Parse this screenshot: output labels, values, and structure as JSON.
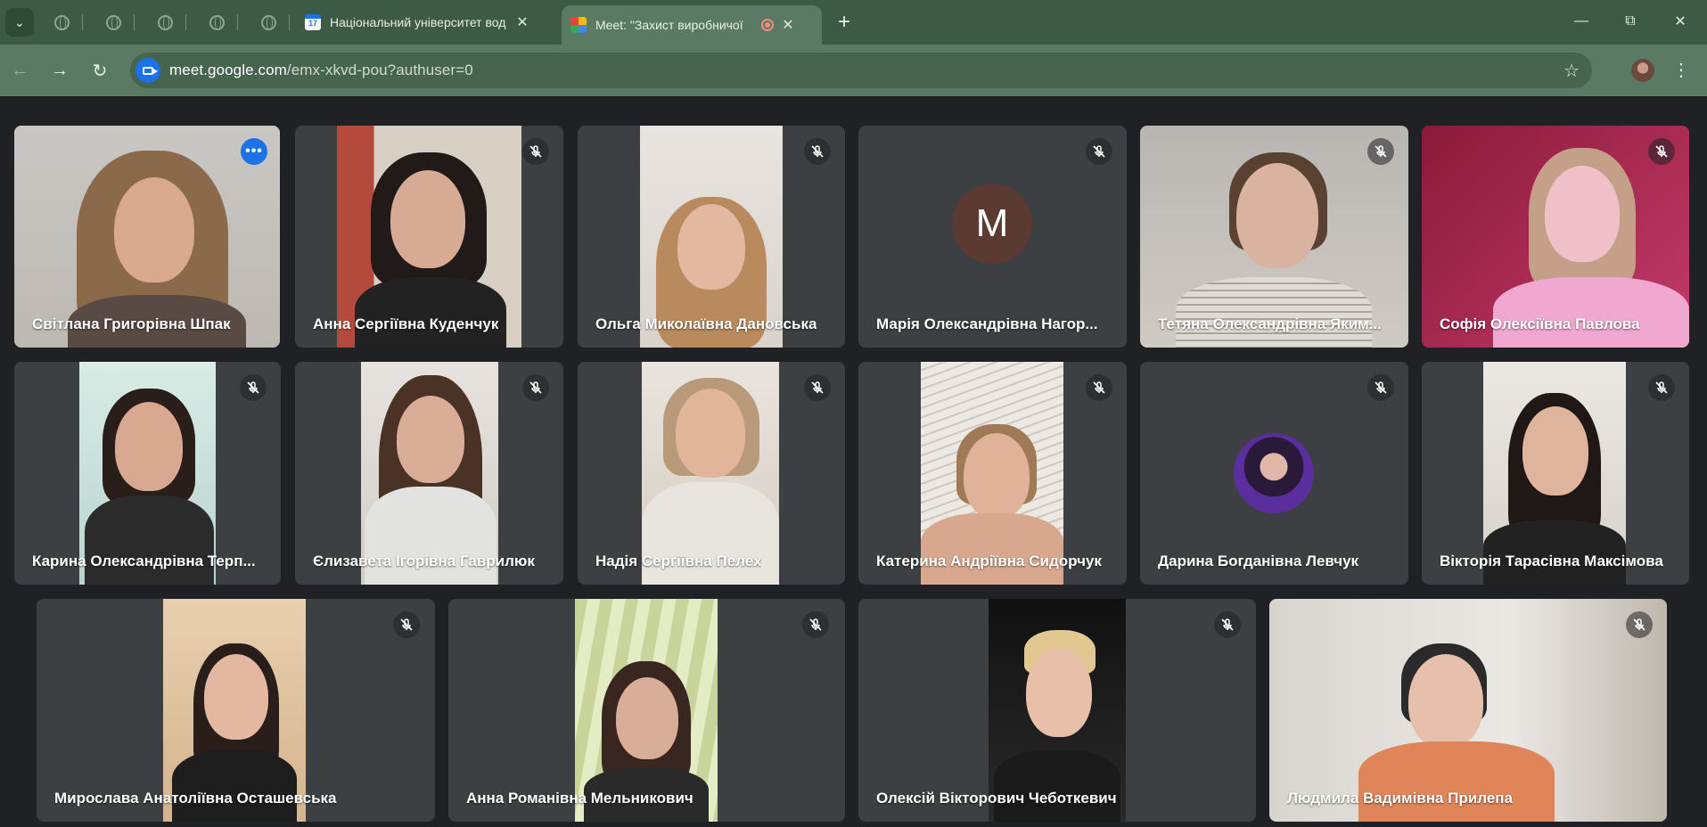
{
  "browser": {
    "tabs": [
      {
        "title": "Національний університет вод"
      },
      {
        "title": "Meet: \"Захист виробничої"
      }
    ],
    "tab1_favicon_text": "17",
    "url_host": "meet.google.com",
    "url_path": "/emx-xkvd-pou?authuser=0"
  },
  "meet": {
    "avatar_letter": "M",
    "participants": [
      {
        "name": "Світлана Григорівна Шпак"
      },
      {
        "name": "Анна Сергіївна Куденчук"
      },
      {
        "name": "Ольга Миколаївна Дановська"
      },
      {
        "name": "Марія Олександрівна Нагор..."
      },
      {
        "name": "Тетяна Олександрівна Яким..."
      },
      {
        "name": "Софія Олексіївна Павлова"
      },
      {
        "name": "Карина Олександрівна Терп..."
      },
      {
        "name": "Єлизавета Ігорівна Гаврилюк"
      },
      {
        "name": "Надія Сергіївна Пелех"
      },
      {
        "name": "Катерина Андріївна Сидорчук"
      },
      {
        "name": "Дарина Богданівна Левчук"
      },
      {
        "name": "Вікторія Тарасівна Максімова"
      },
      {
        "name": "Мирослава Анатоліївна Осташевська"
      },
      {
        "name": "Анна Романівна Мельникович"
      },
      {
        "name": "Олексій Вікторович Чеботкевич"
      },
      {
        "name": "Людмила Вадимівна Прилепа"
      }
    ]
  },
  "colors": {
    "chrome_frame": "#3c5a44",
    "toolbar": "#5a7a63",
    "meet_bg": "#202124",
    "tile_bg": "#3c4043",
    "speaking_outline": "#8ab4f8",
    "accent_blue": "#1a73e8"
  }
}
